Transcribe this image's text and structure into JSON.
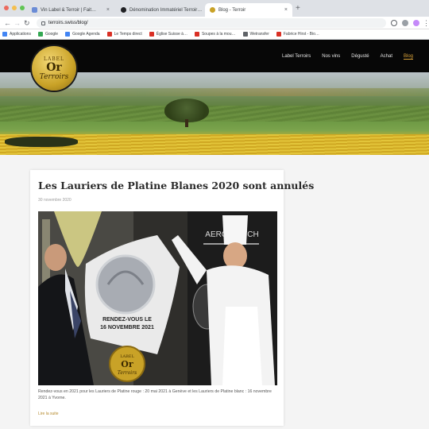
{
  "browser": {
    "tabs": [
      {
        "label": "Vin Label & Terroir | Fait…",
        "color": "#6b8cd6"
      },
      {
        "label": "Dénomination Immatériel Terroir…",
        "color": "#202124"
      },
      {
        "label": "Blog - Terroir",
        "color": "#c9a227"
      }
    ],
    "url": "terroirs.swiss/blog/",
    "bookmarks": [
      {
        "label": "Applications",
        "color": "#4285f4"
      },
      {
        "label": "Google",
        "color": "#34a853"
      },
      {
        "label": "Google Agenda",
        "color": "#4285f4"
      },
      {
        "label": "Le Temps direct",
        "color": "#d93025"
      },
      {
        "label": "Église Suisse à…",
        "color": "#d93025"
      },
      {
        "label": "Soupes à la mou…",
        "color": "#d93025"
      },
      {
        "label": "Wetransfer",
        "color": "#5f6368"
      },
      {
        "label": "Fabrice Hirst - Bio…",
        "color": "#d93025"
      }
    ]
  },
  "site": {
    "logo": {
      "line1": "LABEL",
      "line2": "Or",
      "line3": "Terroirs"
    },
    "menu": [
      {
        "label": "Label Terroirs",
        "active": false
      },
      {
        "label": "Nos vins",
        "active": false
      },
      {
        "label": "Dégusté",
        "active": false
      },
      {
        "label": "Achat",
        "active": false
      },
      {
        "label": "Blog",
        "active": true
      }
    ]
  },
  "article": {
    "title": "Les Lauriers de Platine Blanes 2020 sont annulés",
    "date": "30 novembre 2020",
    "photo": {
      "banner": "AEROSPATCH",
      "sign_line1": "RENDEZ-VOUS LE",
      "sign_line2": "16 NOVEMBRE 2021",
      "badge_line1": "LABEL",
      "badge_line2": "Or",
      "badge_line3": "Terroirs"
    },
    "excerpt": "Rendez-vous en 2021 pour les Lauriers de Platine rouge : 20 mai 2021 à Genève et les Lauriers de Platine blanc : 16 novembre 2021 à Yvorne.",
    "read_more": "Lire la suite"
  }
}
